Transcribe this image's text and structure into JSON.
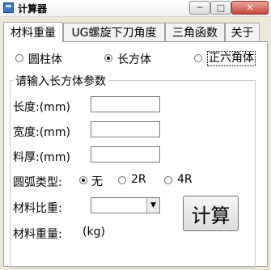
{
  "window": {
    "title": "计算器",
    "min_glyph": "─",
    "max_glyph": "□",
    "close_glyph": "✕"
  },
  "tabs": [
    {
      "label": "材料重量",
      "active": true
    },
    {
      "label": "UG螺旋下刀角度",
      "active": false
    },
    {
      "label": "三角函数",
      "active": false
    },
    {
      "label": "关于",
      "active": false
    }
  ],
  "shapes": [
    {
      "label": "圆柱体",
      "selected": false
    },
    {
      "label": "长方体",
      "selected": true
    },
    {
      "label": "正六角体",
      "selected": false
    }
  ],
  "group": {
    "title": "请输入长方体参数",
    "length_label": "长度:(mm)",
    "width_label": "宽度:(mm)",
    "thickness_label": "料厚:(mm)",
    "length_value": "",
    "width_value": "",
    "thickness_value": "",
    "arc_label": "圆弧类型:",
    "arc_options": [
      {
        "label": "无",
        "selected": true
      },
      {
        "label": "2R",
        "selected": false
      },
      {
        "label": "4R",
        "selected": false
      }
    ],
    "density_label": "材料比重:",
    "density_value": "",
    "weight_label": "材料重量:",
    "weight_unit": "(kg)",
    "calc_button": "计算"
  },
  "icons": {
    "combo_arrow": "dropdown-arrow-icon"
  }
}
